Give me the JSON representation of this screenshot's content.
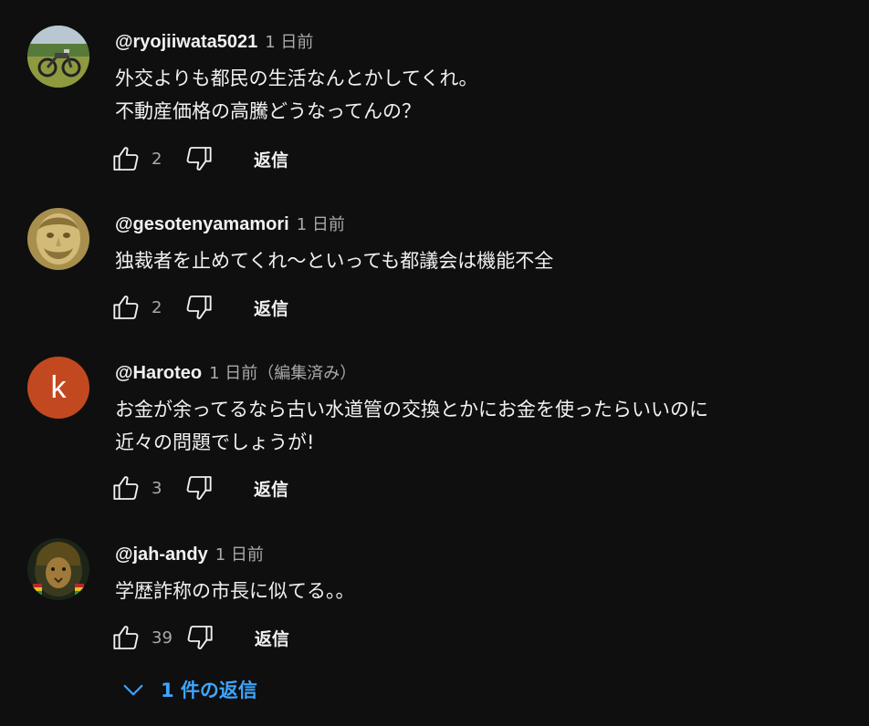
{
  "comments": [
    {
      "author": "@ryojiiwata5021",
      "time": "1 日前",
      "lines": [
        "外交よりも都民の生活なんとかしてくれ。",
        "不動産価格の高騰どうなってんの？"
      ],
      "likes": "2",
      "reply_label": "返信",
      "avatar_icon": "motorcycle-photo-avatar"
    },
    {
      "author": "@gesotenyamamori",
      "time": "1 日前",
      "lines": [
        "独裁者を止めてくれ〜といっても都議会は機能不全"
      ],
      "likes": "2",
      "reply_label": "返信",
      "avatar_icon": "golden-face-avatar"
    },
    {
      "author": "@Haroteo",
      "time": "1 日前（編集済み）",
      "lines": [
        "お金が余ってるなら古い水道管の交換とかにお金を使ったらいいのに",
        "近々の問題でしょうが!"
      ],
      "likes": "3",
      "reply_label": "返信",
      "avatar_letter": "k",
      "avatar_color": "#c2491f"
    },
    {
      "author": "@jah-andy",
      "time": "1 日前",
      "lines": [
        "学歴詐称の市長に似てる。。"
      ],
      "likes": "39",
      "reply_label": "返信",
      "avatar_icon": "lion-avatar"
    }
  ],
  "view_replies_label": "1 件の返信",
  "colors": {
    "background": "#0f0f0f",
    "text": "#f1f1f1",
    "secondary": "#aaaaaa",
    "link": "#3ea6ff"
  }
}
